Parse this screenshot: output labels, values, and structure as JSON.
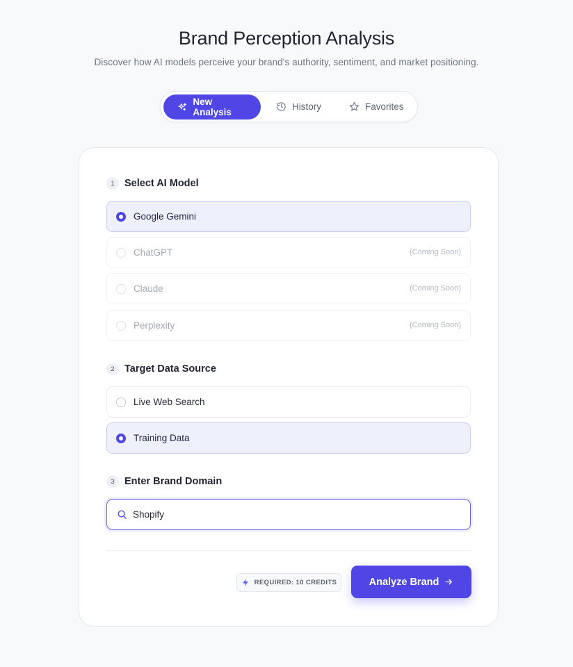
{
  "header": {
    "title": "Brand Perception Analysis",
    "subtitle": "Discover how AI models perceive your brand's authority, sentiment, and market positioning."
  },
  "tabs": [
    {
      "label": "New Analysis",
      "icon": "sparkles-icon",
      "active": true
    },
    {
      "label": "History",
      "icon": "history-icon",
      "active": false
    },
    {
      "label": "Favorites",
      "icon": "star-icon",
      "active": false
    }
  ],
  "sections": {
    "model": {
      "step": "1",
      "label": "Select AI Model",
      "options": [
        {
          "label": "Google Gemini",
          "selected": true,
          "disabled": false,
          "note": ""
        },
        {
          "label": "ChatGPT",
          "selected": false,
          "disabled": true,
          "note": "(Coming Soon)"
        },
        {
          "label": "Claude",
          "selected": false,
          "disabled": true,
          "note": "(Coming Soon)"
        },
        {
          "label": "Perplexity",
          "selected": false,
          "disabled": true,
          "note": "(Coming Soon)"
        }
      ]
    },
    "source": {
      "step": "2",
      "label": "Target Data Source",
      "options": [
        {
          "label": "Live Web Search",
          "selected": false
        },
        {
          "label": "Training Data",
          "selected": true
        }
      ]
    },
    "domain": {
      "step": "3",
      "label": "Enter Brand Domain",
      "value": "Shopify",
      "icon": "search-icon"
    }
  },
  "footer": {
    "credits_label": "REQUIRED: 10 CREDITS",
    "credits_icon": "bolt-icon",
    "analyze_label": "Analyze Brand",
    "analyze_icon": "arrow-right-icon"
  },
  "colors": {
    "accent": "#4f46e5",
    "selected_bg": "#eef0fb",
    "page_bg": "#f8f9fb"
  }
}
